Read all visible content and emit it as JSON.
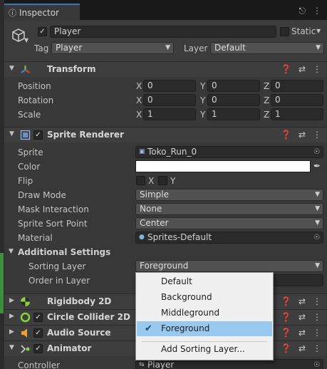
{
  "tab": {
    "icon": "info-icon",
    "title": "Inspector",
    "tools": [
      "lock-icon",
      "kebab-icon"
    ]
  },
  "gameobject": {
    "active": true,
    "name": "Player",
    "static_label": "Static",
    "tag_label": "Tag",
    "tag_value": "Player",
    "layer_label": "Layer",
    "layer_value": "Default"
  },
  "transform": {
    "title": "Transform",
    "rows": [
      {
        "label": "Position",
        "x": "0",
        "y": "0",
        "z": "0"
      },
      {
        "label": "Rotation",
        "x": "0",
        "y": "0",
        "z": "0"
      },
      {
        "label": "Scale",
        "x": "1",
        "y": "1",
        "z": "1"
      }
    ],
    "axis": {
      "x": "X",
      "y": "Y",
      "z": "Z"
    }
  },
  "sprite_renderer": {
    "title": "Sprite Renderer",
    "enabled": true,
    "sprite_label": "Sprite",
    "sprite_value": "Toko_Run_0",
    "color_label": "Color",
    "color_value": "#ffffff",
    "flip_label": "Flip",
    "flip_x": "X",
    "flip_y": "Y",
    "draw_mode_label": "Draw Mode",
    "draw_mode_value": "Simple",
    "mask_label": "Mask Interaction",
    "mask_value": "None",
    "sort_point_label": "Sprite Sort Point",
    "sort_point_value": "Center",
    "material_label": "Material",
    "material_value": "Sprites-Default",
    "additional_label": "Additional Settings",
    "sorting_layer_label": "Sorting Layer",
    "sorting_layer_value": "Foreground",
    "order_label": "Order in Layer"
  },
  "components": {
    "rigidbody": "Rigidbody 2D",
    "collider": "Circle Collider 2D",
    "audio": "Audio Source",
    "animator": "Animator"
  },
  "animator": {
    "controller_label": "Controller",
    "controller_value": "Player"
  },
  "sorting_menu": {
    "items": [
      "Default",
      "Background",
      "Middleground",
      "Foreground"
    ],
    "selected": "Foreground",
    "add_label": "Add Sorting Layer..."
  },
  "colors": {
    "selection": "#99c9ef",
    "tab_accent": "#3a79bb"
  }
}
